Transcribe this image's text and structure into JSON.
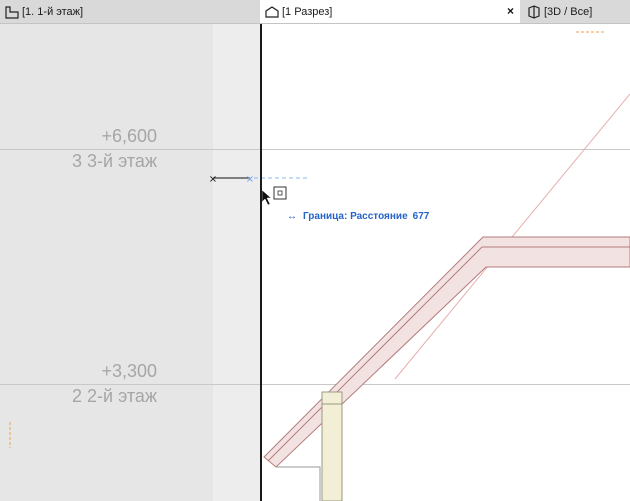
{
  "tabs": [
    {
      "label": "[1. 1-й этаж]",
      "icon": "floor-plan-icon",
      "active": false
    },
    {
      "label": "[1 Разрез]",
      "icon": "section-icon",
      "active": true,
      "close": "×"
    },
    {
      "label": "[3D / Все]",
      "icon": "cube-3d-icon",
      "active": false
    }
  ],
  "levels": [
    {
      "elevation": "+6,600",
      "name": "3 3-й этаж"
    },
    {
      "elevation": "+3,300",
      "name": "2 2-й этаж"
    }
  ],
  "tracker": {
    "arrow": "↔",
    "label": "Граница: Расстояние",
    "value": "677"
  },
  "colors": {
    "accent_blue": "#2563c9",
    "roof_fill": "#f2e2e2",
    "roof_stroke": "#b57c7c",
    "column_fill": "#f2efd6",
    "marker_orange": "#f0a050"
  }
}
